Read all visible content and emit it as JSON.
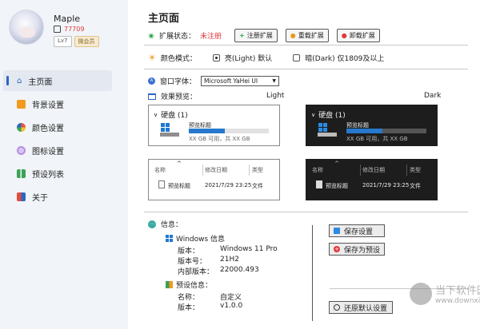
{
  "profile": {
    "name": "Maple",
    "uid": "77709",
    "level": "Lv7",
    "vip": "微会员"
  },
  "nav": {
    "items": [
      {
        "label": "主页面",
        "active": true,
        "color": "#2b66c4"
      },
      {
        "label": "背景设置",
        "active": false,
        "color": "#f29a1e"
      },
      {
        "label": "颜色设置",
        "active": false,
        "color": "#e9553d"
      },
      {
        "label": "图标设置",
        "active": false,
        "color": "#b48ee3"
      },
      {
        "label": "预设列表",
        "active": false,
        "color": "#3aa356"
      },
      {
        "label": "关于",
        "active": false,
        "color": "#e24c3c"
      }
    ]
  },
  "main": {
    "title": "主页面",
    "ext_status_label": "扩展状态：",
    "ext_status_value": "未注册",
    "btn_register": "注册扩展",
    "btn_reload": "重载扩展",
    "btn_uninstall": "卸载扩展",
    "color_mode_label": "颜色模式：",
    "light_option": "亮(Light) 默认",
    "dark_option": "暗(Dark) 仅1809及以上",
    "font_label": "窗口字体：",
    "font_value": "Microsoft YaHei UI",
    "preview_label": "效果预览：",
    "light_title": "Light",
    "dark_title": "Dark"
  },
  "preview": {
    "drive_header": "硬盘 (1)",
    "drive_name": "预览标题",
    "drive_sub": "XX GB 可用，共 XX GB",
    "drive_fill": 0.45,
    "col_name": "名称",
    "col_date": "修改日期",
    "col_type": "类型",
    "file_name": "预览标题",
    "file_date": "2021/7/29 23:25",
    "file_type": "文件"
  },
  "info": {
    "heading": "信息：",
    "windows_title": "Windows 信息",
    "rows": [
      {
        "k": "版本：",
        "v": "Windows 11 Pro"
      },
      {
        "k": "版本号：",
        "v": "21H2"
      },
      {
        "k": "内部版本：",
        "v": "22000.493"
      }
    ],
    "preset_title": "预设信息：",
    "preset_rows": [
      {
        "k": "名称：",
        "v": "自定义"
      },
      {
        "k": "版本：",
        "v": "v1.0.0"
      }
    ]
  },
  "actions": {
    "save": "保存设置",
    "save_preset": "保存为预设",
    "restore": "还原默认设置"
  },
  "watermark": {
    "title": "当下软件园",
    "url": "www.downxia.com"
  }
}
